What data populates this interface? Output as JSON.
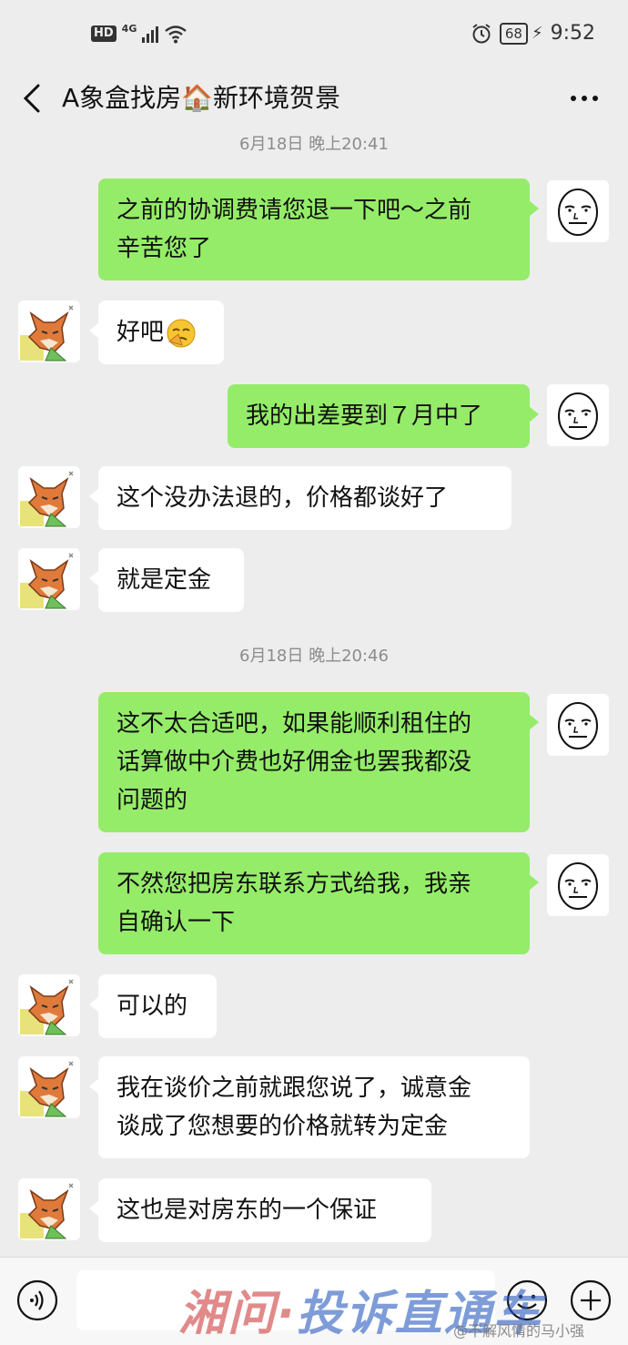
{
  "status_bar": {
    "hd": "HD",
    "network": "4G",
    "battery": "68",
    "time": "9:52",
    "icons": [
      "signal-icon",
      "wifi-icon",
      "alarm-icon",
      "battery-icon",
      "charging-icon"
    ]
  },
  "header": {
    "title": "A象盒找房🏠新环境贺景",
    "back_icon": "chevron-left-icon",
    "more_icon": "more-dots-icon"
  },
  "timestamps": [
    "6月18日 晚上20:41",
    "6月18日 晚上20:46"
  ],
  "messages": [
    {
      "sender": "me",
      "lines": [
        "之前的协调费请您退一下吧～之前",
        "辛苦您了"
      ]
    },
    {
      "sender": "them",
      "lines": [
        "好吧"
      ],
      "emoji": "facepalm-emoji"
    },
    {
      "sender": "me",
      "lines": [
        "我的出差要到７月中了"
      ]
    },
    {
      "sender": "them",
      "lines": [
        "这个没办法退的，价格都谈好了"
      ]
    },
    {
      "sender": "them",
      "lines": [
        "就是定金"
      ]
    },
    {
      "sender": "me",
      "lines": [
        "这不太合适吧，如果能顺利租住的",
        "话算做中介费也好佣金也罢我都没",
        "问题的"
      ]
    },
    {
      "sender": "me",
      "lines": [
        "不然您把房东联系方式给我，我亲",
        "自确认一下"
      ]
    },
    {
      "sender": "them",
      "lines": [
        "可以的"
      ]
    },
    {
      "sender": "them",
      "lines": [
        "我在谈价之前就跟您说了，诚意金",
        "谈成了您想要的价格就转为定金"
      ]
    },
    {
      "sender": "them",
      "lines": [
        "这也是对房东的一个保证"
      ]
    }
  ],
  "avatars": {
    "me": "meme-face-avatar",
    "them": "fox-avatar"
  },
  "bottom_bar": {
    "voice_icon": "voice-icon",
    "emoji_icon": "smiley-icon",
    "plus_icon": "plus-icon"
  },
  "watermark": {
    "part1": "湘问·",
    "part2": "投诉直通车",
    "weibo": "@不解风情的马小强"
  },
  "colors": {
    "my_bubble": "#95ec69",
    "their_bubble": "#ffffff",
    "background": "#ededed"
  }
}
